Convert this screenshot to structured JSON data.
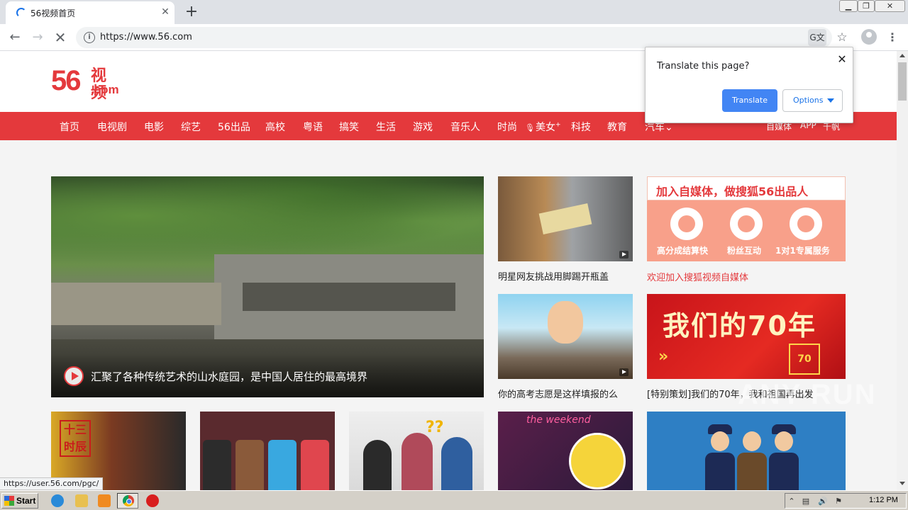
{
  "browser": {
    "tab": {
      "title": "56视频首页",
      "close": "✕"
    },
    "new_tab": "+",
    "window_controls": {
      "minimize": "▁",
      "maximize": "❐",
      "close": "✕"
    },
    "nav": {
      "back": "←",
      "forward": "→",
      "stop": "✕"
    },
    "omnibox": {
      "url": "https://www.56.com",
      "info": "i",
      "translate": "G文",
      "star": "☆",
      "menu": "⋮"
    },
    "status_url": "https://user.56.com/pgc/"
  },
  "site": {
    "logo": {
      "number": "56",
      "cn": "视频",
      "domain": ".com"
    },
    "nav_items": [
      "首页",
      "电视剧",
      "电影",
      "综艺",
      "56出品",
      "高校",
      "粤语",
      "搞笑",
      "生活",
      "游戏",
      "音乐人",
      "时尚",
      "美女",
      "科技",
      "教育",
      "汽车"
    ],
    "nav_mic": "🎙",
    "nav_plus": "+",
    "nav_caret": "⌄",
    "nav_right": [
      "自媒体",
      "APP",
      "千帆"
    ],
    "hero_caption": "汇聚了各种传统艺术的山水庭园，是中国人居住的最高境界",
    "videos": [
      {
        "title": "明星网友挑战用脚踢开瓶盖"
      },
      {
        "title": "你的高考志愿是这样填报的么"
      }
    ],
    "promo1": {
      "title": "加入自媒体，做搜狐56出品人",
      "features": [
        "高分成结算快",
        "粉丝互动",
        "1对1专属服务"
      ],
      "label": "欢迎加入搜狐视频自媒体"
    },
    "promo2": {
      "title": "我们的70年",
      "arrows": "»",
      "badge": "70",
      "label": "[特别策划]我们的70年，我和祖国再出发"
    },
    "b1_seal": "十三\n时辰",
    "b3_marks": "??",
    "b4_sign": "the weekend",
    "watermark": "ANY RUN"
  },
  "translate_popup": {
    "title": "Translate this page?",
    "translate_button": "Translate",
    "options_button": "Options",
    "close": "✕"
  },
  "taskbar": {
    "start": "Start",
    "clock": "1:12 PM",
    "tray_icons": [
      "⌃",
      "▤",
      "🔊",
      "⚑"
    ]
  }
}
